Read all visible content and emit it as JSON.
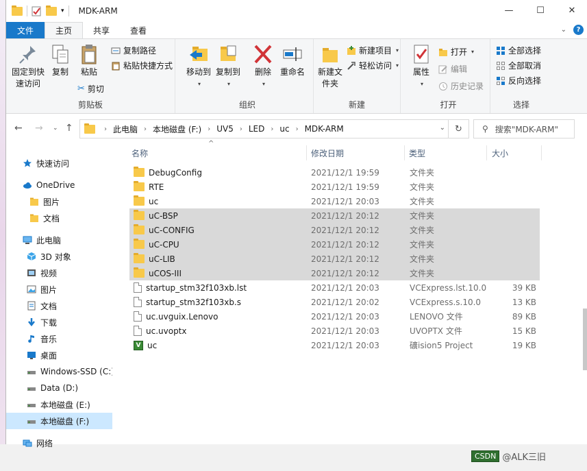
{
  "window": {
    "title": "MDK-ARM",
    "minimize": "—",
    "maximize": "☐",
    "close": "✕"
  },
  "tabs": {
    "file": "文件",
    "home": "主页",
    "share": "共享",
    "view": "查看"
  },
  "ribbon": {
    "clipboard": {
      "label": "剪贴板",
      "pin": "固定到快速访问",
      "copy": "复制",
      "paste": "粘贴",
      "copy_path": "复制路径",
      "paste_shortcut": "粘贴快捷方式",
      "cut": "剪切"
    },
    "organize": {
      "label": "组织",
      "move_to": "移动到",
      "copy_to": "复制到",
      "delete": "删除",
      "rename": "重命名"
    },
    "new": {
      "label": "新建",
      "new_folder": "新建文件夹",
      "new_item": "新建项目",
      "easy_access": "轻松访问"
    },
    "open": {
      "label": "打开",
      "properties": "属性",
      "open": "打开",
      "edit": "编辑",
      "history": "历史记录"
    },
    "select": {
      "label": "选择",
      "select_all": "全部选择",
      "select_none": "全部取消",
      "invert": "反向选择"
    }
  },
  "address": {
    "crumbs": [
      "此电脑",
      "本地磁盘 (F:)",
      "UV5",
      "LED",
      "uc",
      "MDK-ARM"
    ],
    "search_placeholder": "搜索\"MDK-ARM\""
  },
  "nav": [
    {
      "label": "快速访问",
      "icon": "star-icon"
    },
    {
      "label": "OneDrive",
      "icon": "cloud-icon"
    },
    {
      "label": "图片",
      "icon": "folder-icon"
    },
    {
      "label": "文档",
      "icon": "folder-icon"
    },
    {
      "label": "此电脑",
      "icon": "pc-icon"
    },
    {
      "label": "3D 对象",
      "icon": "cube-icon"
    },
    {
      "label": "视频",
      "icon": "video-icon"
    },
    {
      "label": "图片",
      "icon": "picture-icon"
    },
    {
      "label": "文档",
      "icon": "document-icon"
    },
    {
      "label": "下载",
      "icon": "download-icon"
    },
    {
      "label": "音乐",
      "icon": "music-icon"
    },
    {
      "label": "桌面",
      "icon": "desktop-icon"
    },
    {
      "label": "Windows-SSD (C:)",
      "icon": "drive-icon"
    },
    {
      "label": "Data (D:)",
      "icon": "drive-icon"
    },
    {
      "label": "本地磁盘 (E:)",
      "icon": "drive-icon"
    },
    {
      "label": "本地磁盘 (F:)",
      "icon": "drive-icon"
    },
    {
      "label": "网络",
      "icon": "network-icon"
    }
  ],
  "columns": {
    "name": "名称",
    "date": "修改日期",
    "type": "类型",
    "size": "大小"
  },
  "files": [
    {
      "name": "DebugConfig",
      "date": "2021/12/1 19:59",
      "type": "文件夹",
      "size": "",
      "icon": "folder"
    },
    {
      "name": "RTE",
      "date": "2021/12/1 19:59",
      "type": "文件夹",
      "size": "",
      "icon": "folder"
    },
    {
      "name": "uc",
      "date": "2021/12/1 20:03",
      "type": "文件夹",
      "size": "",
      "icon": "folder"
    },
    {
      "name": "uC-BSP",
      "date": "2021/12/1 20:12",
      "type": "文件夹",
      "size": "",
      "icon": "folder"
    },
    {
      "name": "uC-CONFIG",
      "date": "2021/12/1 20:12",
      "type": "文件夹",
      "size": "",
      "icon": "folder"
    },
    {
      "name": "uC-CPU",
      "date": "2021/12/1 20:12",
      "type": "文件夹",
      "size": "",
      "icon": "folder"
    },
    {
      "name": "uC-LIB",
      "date": "2021/12/1 20:12",
      "type": "文件夹",
      "size": "",
      "icon": "folder"
    },
    {
      "name": "uCOS-III",
      "date": "2021/12/1 20:12",
      "type": "文件夹",
      "size": "",
      "icon": "folder"
    },
    {
      "name": "startup_stm32f103xb.lst",
      "date": "2021/12/1 20:03",
      "type": "VCExpress.lst.10.0",
      "size": "39 KB",
      "icon": "file"
    },
    {
      "name": "startup_stm32f103xb.s",
      "date": "2021/12/1 20:02",
      "type": "VCExpress.s.10.0",
      "size": "13 KB",
      "icon": "file"
    },
    {
      "name": "uc.uvguix.Lenovo",
      "date": "2021/12/1 20:03",
      "type": "LENOVO 文件",
      "size": "89 KB",
      "icon": "file"
    },
    {
      "name": "uc.uvoptx",
      "date": "2021/12/1 20:03",
      "type": "UVOPTX 文件",
      "size": "15 KB",
      "icon": "file"
    },
    {
      "name": "uc",
      "date": "2021/12/1 20:03",
      "type": "礦ision5 Project",
      "size": "19 KB",
      "icon": "mdk"
    }
  ],
  "watermark": {
    "text1": "CSDN",
    "text2": "@ALK三旧"
  }
}
